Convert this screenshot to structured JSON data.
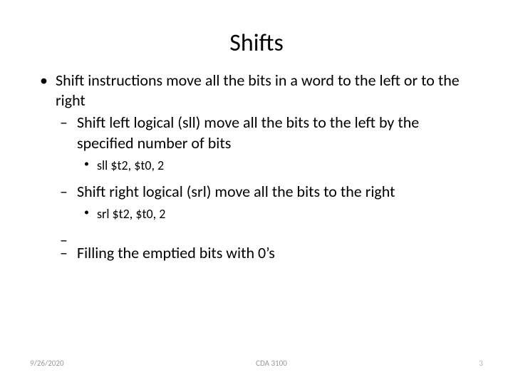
{
  "title": "Shifts",
  "bullets": {
    "main": "Shift instructions move all the bits in a word to the left or to the right",
    "sub1": "Shift left logical (sll) move all the bits to the left by the specified number of bits",
    "sub1ex": "sll $t2, $t0, 2",
    "sub2": "Shift right logical (srl) move all the bits to the right",
    "sub2ex": "srl $t2, $t0, 2",
    "sub3": "Filling the emptied bits with 0’s"
  },
  "footer": {
    "date": "9/26/2020",
    "course": "CDA 3100",
    "page": "3"
  }
}
